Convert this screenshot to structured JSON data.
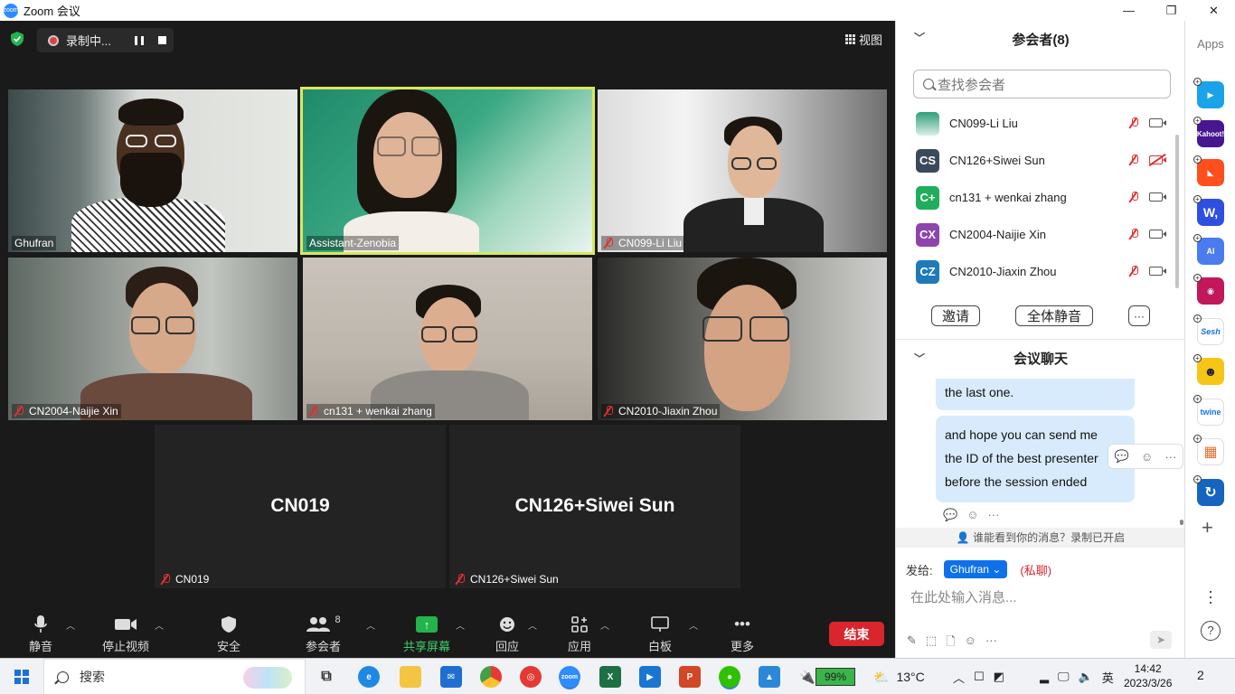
{
  "window": {
    "title": "Zoom 会议",
    "minimize": "—",
    "restore": "❐",
    "close": "✕"
  },
  "recording": {
    "label": "录制中..."
  },
  "view_button": {
    "label": "视图"
  },
  "tiles": [
    {
      "name": "Ghufran",
      "muted": false
    },
    {
      "name": "Assistant-Zenobia",
      "muted": false,
      "active_speaker": true
    },
    {
      "name": "CN099-Li Liu",
      "muted": true
    },
    {
      "name": "CN2004-Naijie Xin",
      "muted": true
    },
    {
      "name": "cn131 + wenkai zhang",
      "muted": true
    },
    {
      "name": "CN2010-Jiaxin Zhou",
      "muted": true
    },
    {
      "name": "CN019",
      "big": "CN019",
      "muted": true
    },
    {
      "name": "CN126+Siwei Sun",
      "big": "CN126+Siwei Sun",
      "muted": true
    }
  ],
  "toolbar": {
    "mute": "静音",
    "stop_video": "停止视频",
    "security": "安全",
    "participants": "参会者",
    "participants_count": "8",
    "share": "共享屏幕",
    "reactions": "回应",
    "apps": "应用",
    "whiteboard": "白板",
    "more": "更多",
    "end": "结束"
  },
  "panel": {
    "participants_title": "参会者(8)",
    "search_placeholder": "查找参会者",
    "participants": [
      {
        "initials": "",
        "name": "CN099-Li Liu",
        "color": "#2f9e7b",
        "video_off": false
      },
      {
        "initials": "CS",
        "name": "CN126+Siwei Sun",
        "color": "#3a4a5c",
        "video_off": true
      },
      {
        "initials": "C+",
        "name": "cn131 + wenkai zhang",
        "color": "#1fae5b",
        "video_off": false
      },
      {
        "initials": "CX",
        "name": "CN2004-Naijie Xin",
        "color": "#8e44ad",
        "video_off": false
      },
      {
        "initials": "CZ",
        "name": "CN2010-Jiaxin Zhou",
        "color": "#1e7ab8",
        "video_off": false
      }
    ],
    "invite": "邀请",
    "mute_all": "全体静音",
    "more": "···",
    "chat_title": "会议聊天",
    "messages": [
      "the last one.",
      "and hope you can send me",
      "the ID of the best presenter",
      "before the session ended"
    ],
    "notice": "谁能看到你的消息？录制已开启",
    "send_to_label": "发给:",
    "send_to_value": "Ghufran",
    "private_label": "(私聊)",
    "input_placeholder": "在此处输入消息..."
  },
  "apps": {
    "title": "Apps",
    "items": [
      {
        "label": "▶",
        "color": "#1aa3e8"
      },
      {
        "label": "Kahoot!",
        "color": "#46178f"
      },
      {
        "label": "◣",
        "color": "#ff4f1f"
      },
      {
        "label": "W,",
        "color": "#2f4fe0"
      },
      {
        "label": "AI",
        "color": "#4a7cf0"
      },
      {
        "label": "◉",
        "color": "#c2185b"
      },
      {
        "label": "Sesh",
        "color": "#ffffff"
      },
      {
        "label": "☻",
        "color": "#f5c518"
      },
      {
        "label": "twine",
        "color": "#ffffff"
      },
      {
        "label": "▦",
        "color": "#ffffff"
      },
      {
        "label": "↻",
        "color": "#1565c0"
      }
    ]
  },
  "taskbar": {
    "search": "搜索",
    "battery": "99%",
    "battery_level": 0.99,
    "temperature": "13°C",
    "ime": "英",
    "time": "14:42",
    "date": "2023/3/26",
    "notifications": "2"
  }
}
